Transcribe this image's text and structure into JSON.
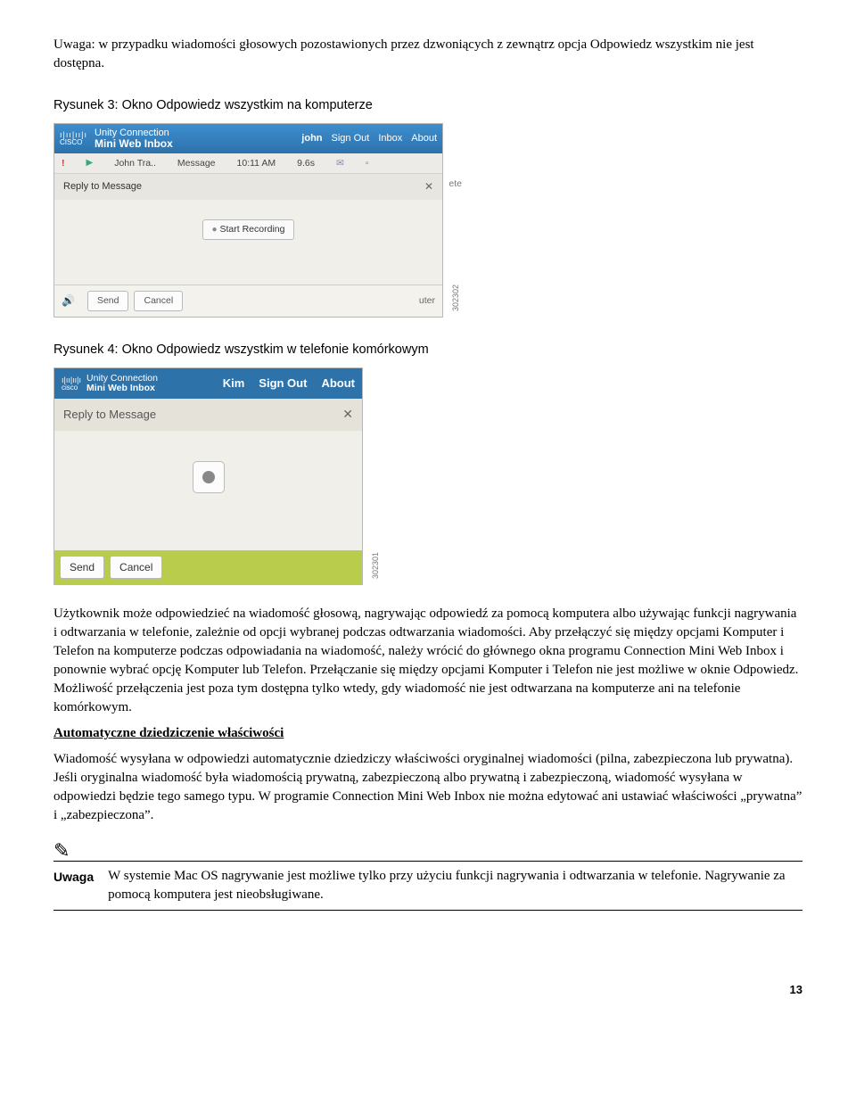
{
  "intro": "Uwaga: w przypadku wiadomości głosowych pozostawionych przez dzwoniących z zewnątrz opcja Odpowiedz wszystkim nie jest dostępna.",
  "fig3_caption": "Rysunek 3: Okno Odpowiedz wszystkim na komputerze",
  "fig4_caption": "Rysunek 4: Okno Odpowiedz wszystkim w telefonie komórkowym",
  "desktop": {
    "brand_top": "ı|ıı|ıı|ı",
    "brand_bottom": "CISCO",
    "title_top": "Unity Connection",
    "title_bottom": "Mini Web Inbox",
    "user": "john",
    "nav_signout": "Sign Out",
    "nav_inbox": "Inbox",
    "nav_about": "About",
    "row_from": "John Tra..",
    "row_subject": "Message",
    "row_time": "10:11 AM",
    "row_dur": "9.6s",
    "modal_title": "Reply to Message",
    "start_rec": "Start Recording",
    "send": "Send",
    "cancel": "Cancel",
    "footer_right": "uter",
    "side_code": "302302",
    "delete_hint": "ete"
  },
  "mobile": {
    "brand_top": "ı|ıı|ıı|ı",
    "brand_bottom": "cisco",
    "title_top": "Unity Connection",
    "title_bottom": "Mini Web Inbox",
    "user": "Kim",
    "nav_signout": "Sign Out",
    "nav_about": "About",
    "modal_title": "Reply to Message",
    "send": "Send",
    "cancel": "Cancel",
    "side_code": "302301"
  },
  "body_para": "Użytkownik może odpowiedzieć na wiadomość głosową, nagrywając odpowiedź za pomocą komputera albo używając funkcji nagrywania i odtwarzania w telefonie, zależnie od opcji wybranej podczas odtwarzania wiadomości. Aby przełączyć się między opcjami Komputer i Telefon na komputerze podczas odpowiadania na wiadomość, należy wrócić do głównego okna programu Connection Mini Web Inbox i ponownie wybrać opcję Komputer lub Telefon. Przełączanie się między opcjami Komputer i Telefon nie jest możliwe w oknie Odpowiedz. Możliwość przełączenia jest poza tym dostępna tylko wtedy, gdy wiadomość nie jest odtwarzana na komputerze ani na telefonie komórkowym.",
  "auto_head": "Automatyczne dziedziczenie właściwości",
  "auto_para": "Wiadomość wysyłana w odpowiedzi automatycznie dziedziczy właściwości oryginalnej wiadomości (pilna, zabezpieczona lub prywatna). Jeśli oryginalna wiadomość była wiadomością prywatną, zabezpieczoną albo prywatną i zabezpieczoną, wiadomość wysyłana w odpowiedzi będzie tego samego typu. W programie Connection Mini Web Inbox nie można edytować ani ustawiać właściwości „prywatna” i „zabezpieczona”.",
  "note_label": "Uwaga",
  "note_text": "W systemie Mac OS nagrywanie jest możliwe tylko przy użyciu funkcji nagrywania i odtwarzania w telefonie. Nagrywanie za pomocą komputera jest nieobsługiwane.",
  "page_number": "13"
}
